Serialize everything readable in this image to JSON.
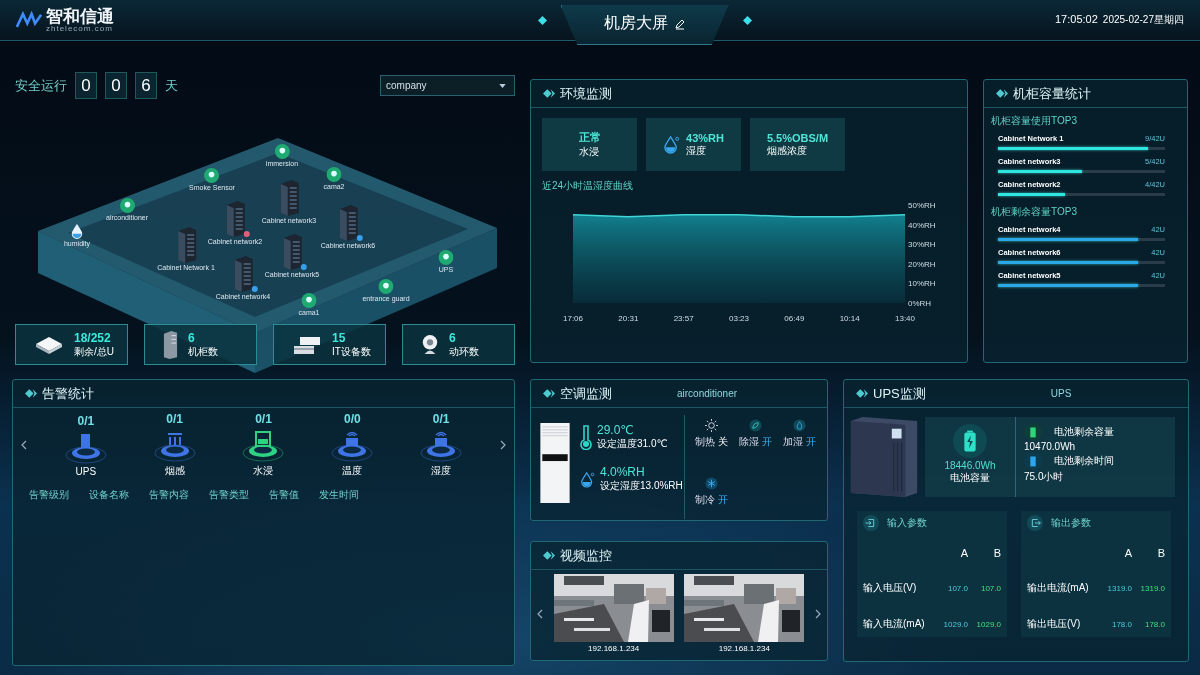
{
  "header": {
    "logo": "智和信通",
    "logo_sub": "zhtelecom.com",
    "title": "机房大屏",
    "time": "17:05:02",
    "date": "2025-02-27星期四"
  },
  "safe_run": {
    "label": "安全运行",
    "digits": [
      "0",
      "0",
      "6"
    ],
    "unit": "天"
  },
  "site_select": {
    "value": "company"
  },
  "room": {
    "devices": [
      {
        "name": "immersion",
        "kind": "sensor"
      },
      {
        "name": "Smoke Sensor",
        "kind": "sensor"
      },
      {
        "name": "cama2",
        "kind": "sensor"
      },
      {
        "name": "airconditioner",
        "kind": "sensor"
      },
      {
        "name": "Cabinet network3",
        "kind": "cabinet"
      },
      {
        "name": "humidity",
        "kind": "droplet"
      },
      {
        "name": "Cabinet network2",
        "kind": "cabinet",
        "color": "#e0607a"
      },
      {
        "name": "Cabinet network6",
        "kind": "cabinet",
        "color": "#3a9ee8"
      },
      {
        "name": "Cabinet Network 1",
        "kind": "cabinet"
      },
      {
        "name": "UPS",
        "kind": "sensor"
      },
      {
        "name": "Cabinet network5",
        "kind": "cabinet",
        "color": "#3a9ee8"
      },
      {
        "name": "entrance guard",
        "kind": "sensor"
      },
      {
        "name": "Cabinet network4",
        "kind": "cabinet",
        "color": "#3a9ee8"
      },
      {
        "name": "cama1",
        "kind": "sensor"
      }
    ]
  },
  "stats": [
    {
      "kind": "u-space",
      "value": "18/252",
      "label": "剩余/总U"
    },
    {
      "kind": "cabinet",
      "value": "6",
      "label": "机柜数"
    },
    {
      "kind": "server",
      "value": "15",
      "label": "IT设备数"
    },
    {
      "kind": "camera",
      "value": "6",
      "label": "动环数"
    }
  ],
  "environment": {
    "title": "环境监测",
    "cards": [
      {
        "kind": "text",
        "value": "正常",
        "label": "水浸"
      },
      {
        "kind": "humidity",
        "value": "43%RH",
        "label": "湿度"
      },
      {
        "kind": "text",
        "value": "5.5%OBS/M",
        "label": "烟感浓度"
      }
    ],
    "chart_title": "近24小时温湿度曲线",
    "chart_data": {
      "type": "area",
      "categories": [
        "17:06",
        "20:31",
        "23:57",
        "03:23",
        "06:49",
        "10:14",
        "13:40"
      ],
      "values": [
        45,
        44,
        45,
        45,
        44,
        44,
        45
      ],
      "ylim": [
        0,
        50
      ],
      "yticks": [
        {
          "value": 0,
          "label": "0%RH"
        },
        {
          "value": 10,
          "label": "10%RH"
        },
        {
          "value": 20,
          "label": "20%RH"
        },
        {
          "value": 30,
          "label": "30%RH"
        },
        {
          "value": 40,
          "label": "40%RH"
        },
        {
          "value": 50,
          "label": "50%RH"
        }
      ]
    }
  },
  "cabinets": {
    "title": "机柜容量统计",
    "groups": [
      {
        "kind": "usage",
        "title": "机柜容量使用TOP3",
        "items": [
          {
            "name": "Cabinet Network 1",
            "value": "9/42U",
            "level": 0.9
          },
          {
            "name": "Cabinet network3",
            "value": "5/42U",
            "level": 0.5
          },
          {
            "name": "Cabinet network2",
            "value": "4/42U",
            "level": 0.4
          }
        ]
      },
      {
        "kind": "remaining",
        "title": "机柜剩余容量TOP3",
        "items": [
          {
            "name": "Cabinet network4",
            "value": "42U",
            "level": 0.84
          },
          {
            "name": "Cabinet network6",
            "value": "42U",
            "level": 0.84
          },
          {
            "name": "Cabinet network5",
            "value": "42U",
            "level": 0.84
          }
        ]
      }
    ]
  },
  "alarms": {
    "title": "告警统计",
    "categories": [
      {
        "kind": "ups",
        "count": "0/1",
        "label": "UPS",
        "color": "#3f74e6"
      },
      {
        "kind": "smoke",
        "count": "0/1",
        "label": "烟感",
        "color": "#3f74e6"
      },
      {
        "kind": "water",
        "count": "0/1",
        "label": "水浸",
        "color": "#2fd283"
      },
      {
        "kind": "sensor",
        "count": "0/0",
        "label": "温度",
        "color": "#3f74e6"
      },
      {
        "kind": "sensor",
        "count": "0/1",
        "label": "湿度",
        "color": "#3f74e6"
      }
    ],
    "columns": [
      "告警级别",
      "设备名称",
      "告警内容",
      "告警类型",
      "告警值",
      "发生时间"
    ]
  },
  "air_conditioner": {
    "title": "空调监测",
    "device": "airconditioner",
    "temperature": "29.0℃",
    "temperature_set": "设定温度31.0℃",
    "humidity": "4.0%RH",
    "humidity_set": "设定湿度13.0%RH",
    "modes": [
      {
        "kind": "heat",
        "label": "制热",
        "state": "关",
        "on": false
      },
      {
        "kind": "dehumidify",
        "label": "除湿",
        "state": "开",
        "on": true
      },
      {
        "kind": "humidify",
        "label": "加湿",
        "state": "开",
        "on": true
      },
      {
        "kind": "cool",
        "label": "制冷",
        "state": "开",
        "on": true
      }
    ]
  },
  "video": {
    "title": "视频监控",
    "cameras": [
      {
        "ip": "192.168.1.234"
      },
      {
        "ip": "192.168.1.234"
      }
    ]
  },
  "ups": {
    "title": "UPS监测",
    "device": "UPS",
    "capacity": "18446.0Wh",
    "capacity_label": "电池容量",
    "remaining": [
      {
        "kind": "capacity",
        "label": "电池剩余容量",
        "value": "10470.0Wh"
      },
      {
        "kind": "time",
        "label": "电池剩余时间",
        "value": "75.0小时"
      }
    ],
    "tables": [
      {
        "kind": "input",
        "title": "输入参数",
        "columns": [
          "A",
          "B"
        ],
        "rows": [
          {
            "label": "输入电压(V)",
            "values": [
              "107.0",
              "107.0"
            ]
          },
          {
            "label": "输入电流(mA)",
            "values": [
              "1029.0",
              "1029.0"
            ]
          }
        ]
      },
      {
        "kind": "output",
        "title": "输出参数",
        "columns": [
          "A",
          "B"
        ],
        "rows": [
          {
            "label": "输出电流(mA)",
            "values": [
              "1319.0",
              "1319.0"
            ]
          },
          {
            "label": "输出电压(V)",
            "values": [
              "178.0",
              "178.0"
            ]
          }
        ]
      }
    ]
  }
}
